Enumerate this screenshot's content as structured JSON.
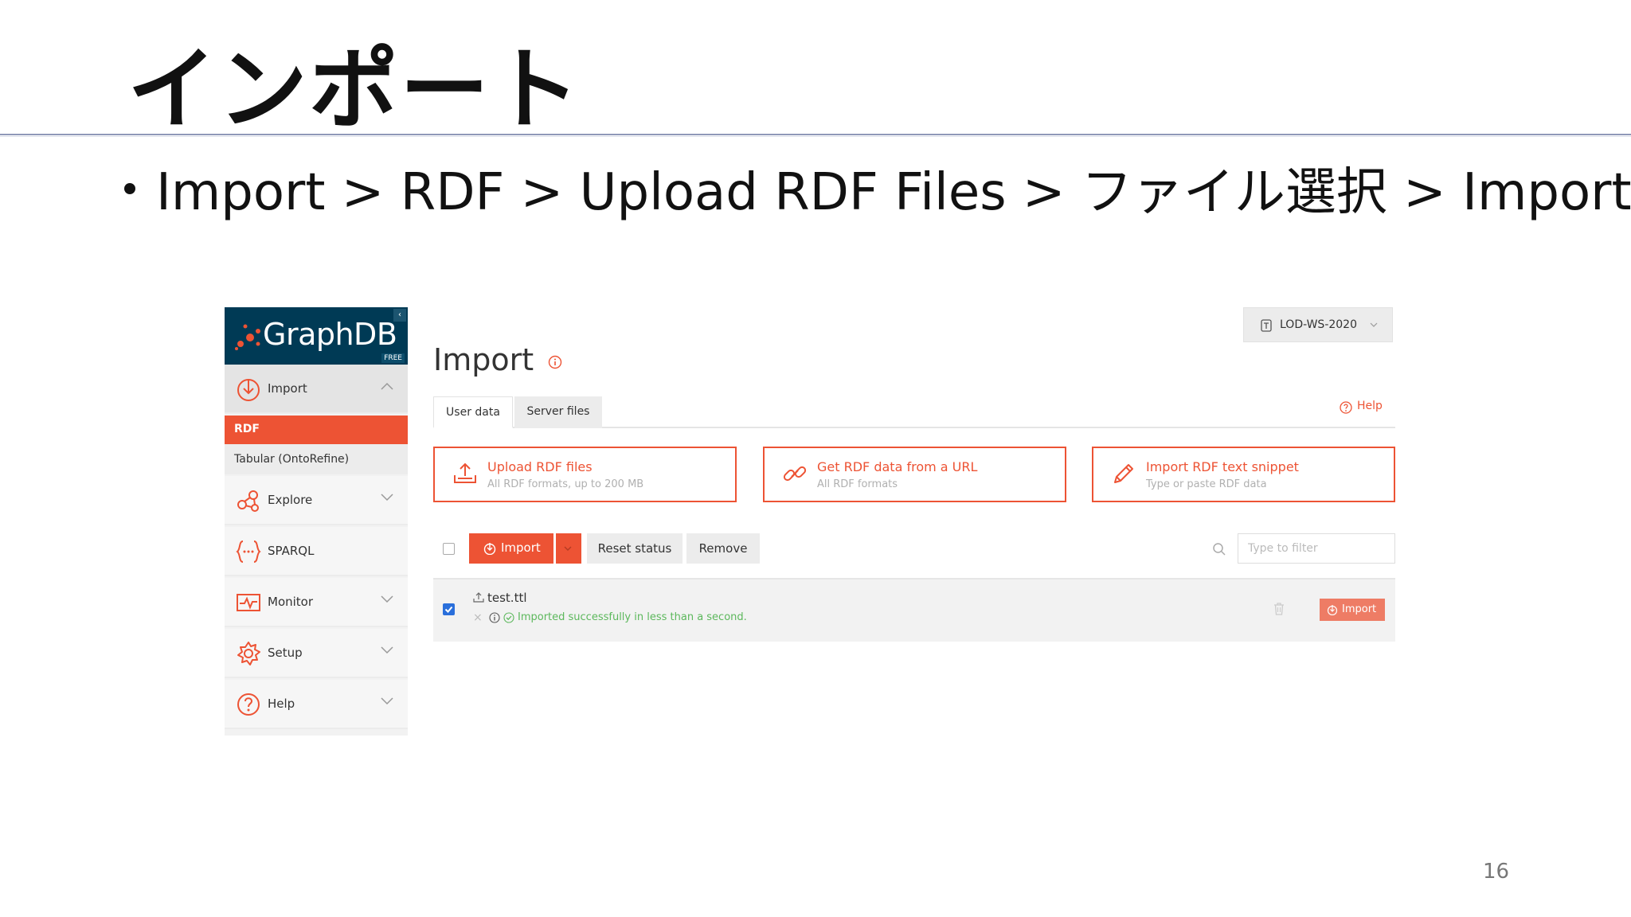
{
  "slide": {
    "title": "インポート",
    "bullet": "Import > RDF > Upload RDF Files > ファイル選択 > Import",
    "page_number": "16"
  },
  "sidebar": {
    "logo": "GraphDB",
    "logo_badge": "FREE",
    "items": [
      {
        "label": "Import",
        "icon": "import-icon"
      },
      {
        "label": "Explore",
        "icon": "explore-icon"
      },
      {
        "label": "SPARQL",
        "icon": "sparql-icon"
      },
      {
        "label": "Monitor",
        "icon": "monitor-icon"
      },
      {
        "label": "Setup",
        "icon": "gear-icon"
      },
      {
        "label": "Help",
        "icon": "help-icon"
      }
    ],
    "sub_items": [
      {
        "label": "RDF",
        "active": true
      },
      {
        "label": "Tabular (OntoRefine)",
        "active": false
      }
    ]
  },
  "header": {
    "repository": "LOD-WS-2020",
    "page_title": "Import"
  },
  "tabs": [
    {
      "label": "User data",
      "active": true
    },
    {
      "label": "Server files",
      "active": false
    }
  ],
  "help_label": "Help",
  "cards": [
    {
      "title": "Upload RDF files",
      "subtitle": "All RDF formats, up to 200 MB",
      "icon": "upload-icon"
    },
    {
      "title": "Get RDF data from a URL",
      "subtitle": "All RDF formats",
      "icon": "link-icon"
    },
    {
      "title": "Import RDF text snippet",
      "subtitle": "Type or paste RDF data",
      "icon": "pencil-icon"
    }
  ],
  "toolbar": {
    "import_label": "Import",
    "reset_label": "Reset status",
    "remove_label": "Remove",
    "filter_placeholder": "Type to filter"
  },
  "files": [
    {
      "name": "test.ttl",
      "status": "Imported successfully in less than a second.",
      "checked": true,
      "action_label": "Import"
    }
  ],
  "colors": {
    "accent": "#ed5334",
    "logo_bg": "#003a55",
    "success": "#5cb85c"
  }
}
